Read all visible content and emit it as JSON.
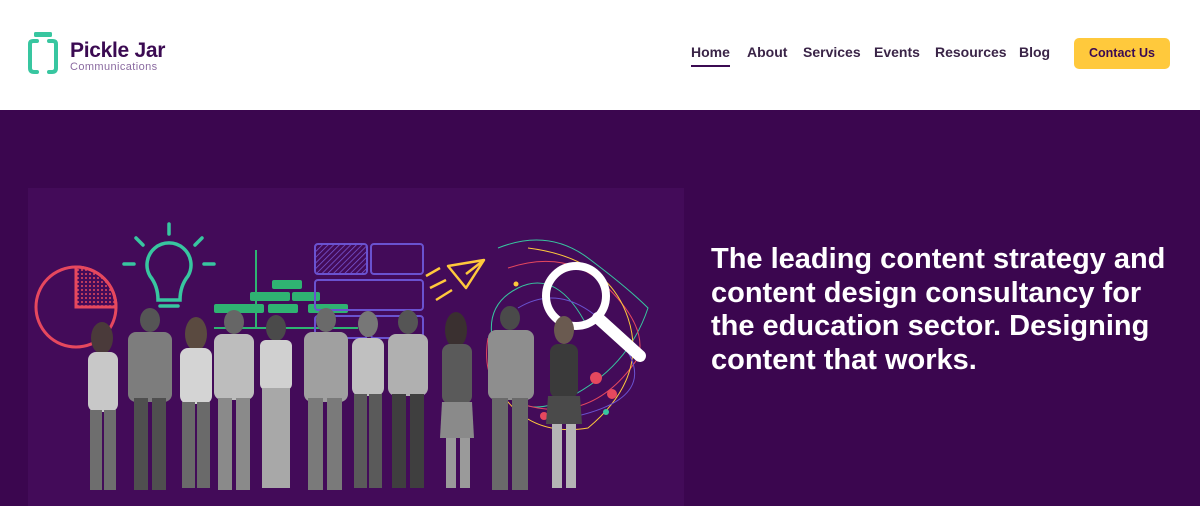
{
  "brand": {
    "name": "Pickle Jar",
    "tagline": "Communications",
    "logo_icon": "jar-icon",
    "color": "#3b0a52",
    "accent": "#38c6a0"
  },
  "nav": {
    "items": [
      {
        "label": "Home",
        "active": true
      },
      {
        "label": "About",
        "active": false
      },
      {
        "label": "Services",
        "active": false
      },
      {
        "label": "Events",
        "active": false
      },
      {
        "label": "Resources",
        "active": false
      },
      {
        "label": "Blog",
        "active": false
      }
    ],
    "cta_label": "Contact Us",
    "cta_color": "#ffc93c"
  },
  "hero": {
    "background": "#3b064f",
    "headline": "The leading content strategy and content design consultancy for the education sector. Designing content that works.",
    "illustration_icons": [
      "pie-chart-icon",
      "lightbulb-icon",
      "bar-chart-icon",
      "calendar-grid-icon",
      "paper-plane-icon",
      "magnifier-icon",
      "network-scribble-icon",
      "people-group"
    ]
  }
}
